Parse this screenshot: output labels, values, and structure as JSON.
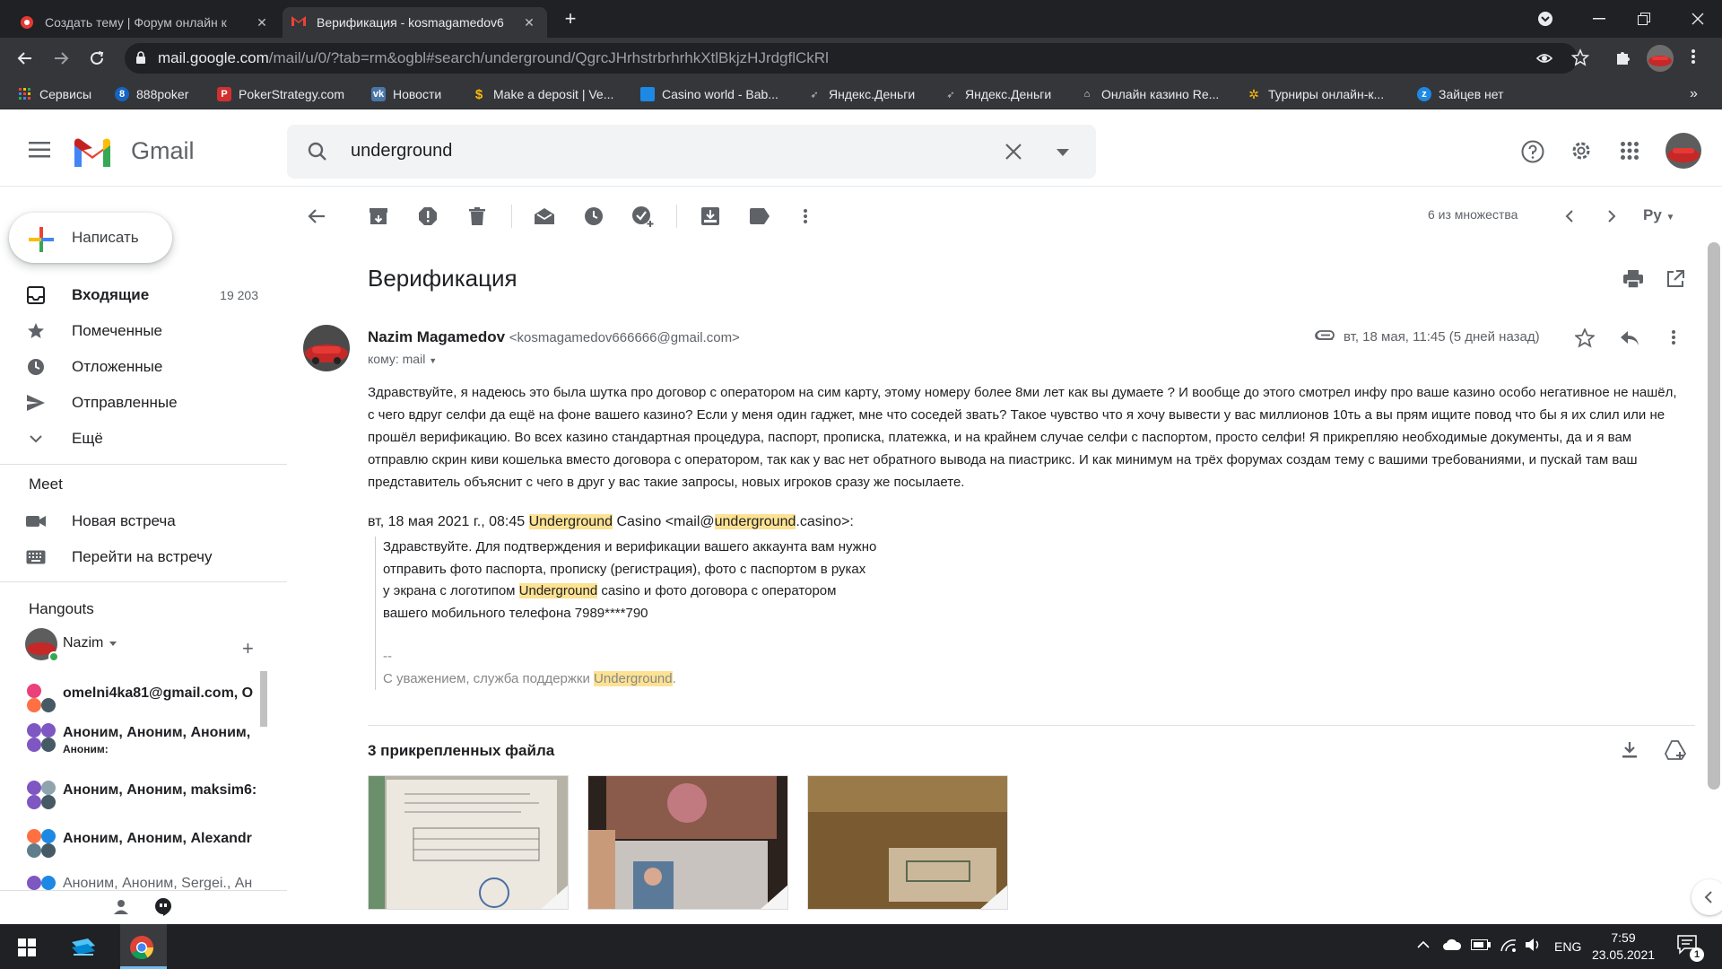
{
  "browser": {
    "tabs": [
      {
        "title": "Создать тему | Форум онлайн к",
        "active": false
      },
      {
        "title": "Верификация - kosmagamedov6",
        "active": true
      }
    ],
    "new_tab": "+",
    "url_host": "mail.google.com",
    "url_path": "/mail/u/0/?tab=rm&ogbl#search/underground/QgrcJHrhstrbrhrhkXtlBkjzHJrdgflCkRl"
  },
  "bookmarks": [
    {
      "label": "Сервисы",
      "icon": "apps-grid-icon",
      "color": "#4285f4"
    },
    {
      "label": "888poker",
      "icon": "888poker-icon",
      "color": "#1565c0"
    },
    {
      "label": "PokerStrategy.com",
      "icon": "pokerstrategy-icon",
      "color": "#d32f2f"
    },
    {
      "label": "Новости",
      "icon": "vk-icon",
      "color": "#4a76a8"
    },
    {
      "label": "Make a deposit | Ve...",
      "icon": "dollar-icon",
      "color": "#35363a"
    },
    {
      "label": "Casino world - Bab...",
      "icon": "casino-icon",
      "color": "#1e88e5"
    },
    {
      "label": "Яндекс.Деньги",
      "icon": "rocket-icon",
      "color": "#35363a"
    },
    {
      "label": "Яндекс.Деньги",
      "icon": "rocket-icon",
      "color": "#35363a"
    },
    {
      "label": "Онлайн казино Re...",
      "icon": "house-icon",
      "color": "#35363a"
    },
    {
      "label": "Турниры онлайн-к...",
      "icon": "gear-icon",
      "color": "#35363a"
    },
    {
      "label": "Зайцев нет",
      "icon": "z-icon",
      "color": "#1e88e5"
    }
  ],
  "gmail": {
    "logo_text": "Gmail",
    "search_query": "underground",
    "compose_label": "Написать",
    "nav": [
      {
        "label": "Входящие",
        "count": "19 203",
        "bold": true
      },
      {
        "label": "Помеченные",
        "count": ""
      },
      {
        "label": "Отложенные",
        "count": ""
      },
      {
        "label": "Отправленные",
        "count": ""
      },
      {
        "label": "Ещё",
        "count": ""
      }
    ],
    "meet": {
      "title": "Meet",
      "new_meeting": "Новая встреча",
      "join": "Перейти на встречу"
    },
    "hangouts": {
      "title": "Hangouts",
      "user": "Nazim",
      "chats": [
        {
          "name": "omelni4ka81@gmail.com, O",
          "sub": ""
        },
        {
          "name": "Аноним, Аноним, Аноним,",
          "sub": "Аноним:"
        },
        {
          "name": "Аноним, Аноним, maksim6:",
          "sub": ""
        },
        {
          "name": "Аноним, Аноним, Alexandr",
          "sub": ""
        },
        {
          "name": "Аноним, Аноним, Sergei., Ан",
          "sub": ""
        }
      ]
    },
    "pager": "6 из множества",
    "lang": "Ру"
  },
  "message": {
    "subject": "Верификация",
    "sender_name": "Nazim Magamedov",
    "sender_email": "<kosmagamedov666666@gmail.com>",
    "to": "кому: mail",
    "date": "вт, 18 мая, 11:45 (5 дней назад)",
    "body": "Здравствуйте, я надеюсь это была шутка про договор с оператором на сим карту, этому номеру более 8ми лет как вы думаете ? И вообще до этого смотрел инфу про ваше казино особо негативное не нашёл, с чего вдруг селфи да ещё на фоне вашего казино? Если у меня один гаджет, мне что соседей звать? Такое чувство что я хочу вывести у вас миллионов 10ть а вы прям ищите повод что бы я их слил или не прошёл верификацию. Во всех казино стандартная процедура, паспорт, прописка, платежка, и на крайнем случае селфи с паспортом, просто селфи! Я прикрепляю необходимые документы, да и я вам отправлю скрин киви кошелька вместо договора с оператором, так как у вас нет обратного вывода на пиастрикс. И как минимум на трёх форумах создам тему с вашими требованиями, и пускай там ваш представитель объяснит с чего в друг у вас такие запросы, новых игроков сразу же посылаете.",
    "quote_header": {
      "prefix": "вт, 18 мая 2021 г., 08:45 ",
      "hl1": "Underground",
      "mid": " Casino <mail@",
      "hl2": "underground",
      "suffix": ".casino>:"
    },
    "quote": {
      "line1": "Здравствуйте. Для подтверждения и верификации вашего аккаунта вам нужно",
      "line2": "отправить фото паспорта, прописку (регистрация), фото с паспортом в руках",
      "line3_a": "у экрана с логотипом ",
      "line3_hl": "Underground",
      "line3_b": " casino и фото договора с оператором",
      "line4": "вашего мобильного телефона 7989****790",
      "sig_dash": "--",
      "sig_a": "С уважением, служба поддержки ",
      "sig_hl": "Underground",
      "sig_b": "."
    },
    "attachments_title": "3 прикрепленных файла"
  },
  "taskbar": {
    "lang": "ENG",
    "time": "7:59",
    "date": "23.05.2021",
    "notifications": "1"
  }
}
